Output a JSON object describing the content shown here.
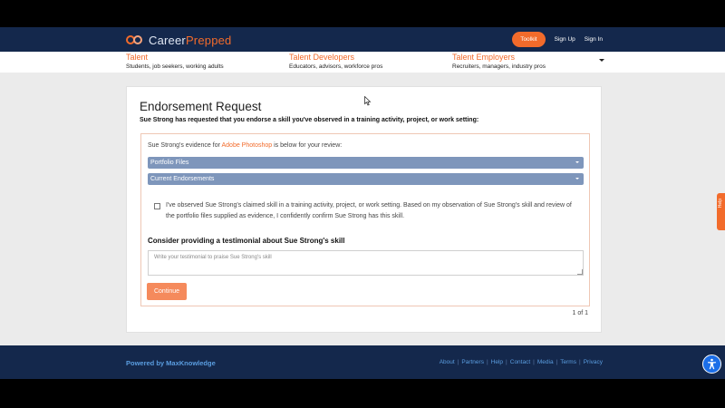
{
  "header": {
    "brand_part1": "Career",
    "brand_part2": "Prepped",
    "toolkit_label": "Toolkit",
    "signup_label": "Sign Up",
    "signin_label": "Sign In"
  },
  "subnav": {
    "items": [
      {
        "title": "Talent",
        "desc": "Students, job seekers, working adults"
      },
      {
        "title": "Talent Developers",
        "desc": "Educators, advisors, workforce pros"
      },
      {
        "title": "Talent Employers",
        "desc": "Recruiters, managers, industry pros"
      }
    ]
  },
  "request": {
    "title": "Endorsement Request",
    "subtitle": "Sue Strong has requested that you endorse a skill you've observed in a training activity, project, or work setting:",
    "evidence_prefix": "Sue Strong's evidence for ",
    "skill_name": "Adobe Photoshop",
    "evidence_suffix": " is below for your review:",
    "accordion_portfolio": "Portfolio Files",
    "accordion_endorsements": "Current Endorsements",
    "confirm_text": "I've observed Sue Strong's claimed skill in a training activity, project, or work setting. Based on my observation of Sue Strong's skill and review of the portfolio files supplied as evidence, I confidently confirm Sue Strong has this skill.",
    "testimonial_heading": "Consider providing a testimonial about Sue Strong's skill",
    "testimonial_placeholder": "Write your testimonial to praise Sue Strong's skill",
    "continue_label": "Continue",
    "pager": "1 of 1"
  },
  "footer": {
    "powered": "Powered by MaxKnowledge",
    "links": [
      "About",
      "Partners",
      "Help",
      "Contact",
      "Media",
      "Terms",
      "Privacy"
    ],
    "separator": "|"
  },
  "side_tab": {
    "label": "Help"
  },
  "icons": {
    "logo": "career-prepped-logo-icon",
    "accessibility": "accessibility-icon",
    "caret": "chevron-down-icon"
  },
  "colors": {
    "navy": "#14284c",
    "orange": "#f26b2b",
    "accordion": "#7e96bb",
    "link_blue": "#5a9de0"
  }
}
